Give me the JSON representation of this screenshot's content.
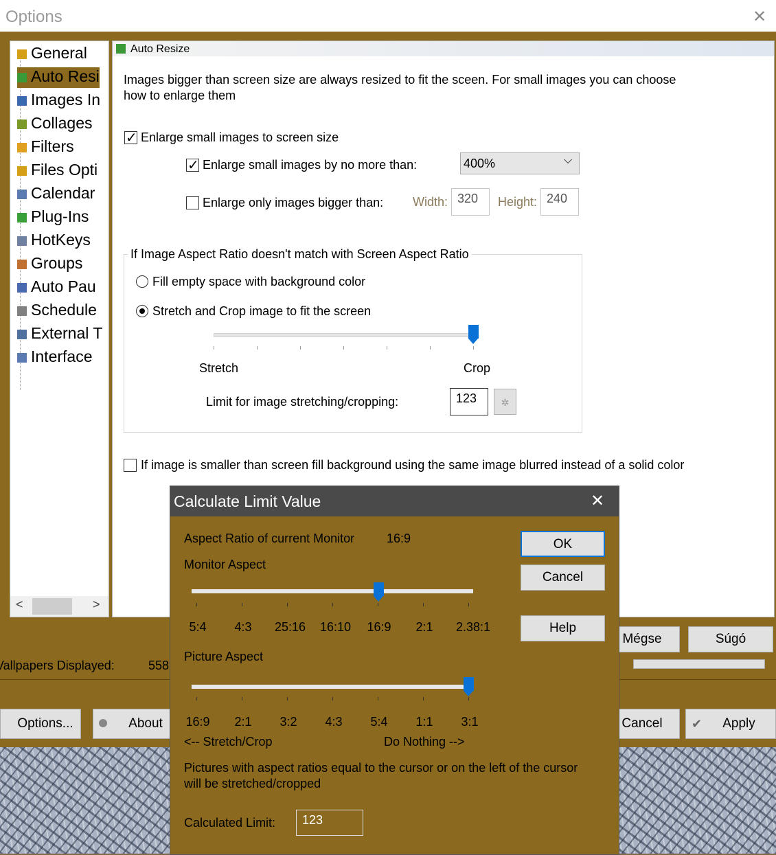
{
  "options_window": {
    "title": "Options",
    "close_glyph": "✕",
    "tree": {
      "items": [
        {
          "label": "General",
          "icon": "pencil-icon",
          "color": "#d4a017"
        },
        {
          "label": "Auto Resi",
          "icon": "resize-icon",
          "color": "#3a9a3a"
        },
        {
          "label": "Images In",
          "icon": "image-icon",
          "color": "#3a6ab0"
        },
        {
          "label": "Collages",
          "icon": "collage-icon",
          "color": "#7a9a2a"
        },
        {
          "label": "Filters",
          "icon": "filter-icon",
          "color": "#e0a020"
        },
        {
          "label": "Files Opti",
          "icon": "files-icon",
          "color": "#d4a017"
        },
        {
          "label": "Calendar",
          "icon": "calendar-icon",
          "color": "#5a7ab0"
        },
        {
          "label": "Plug-Ins",
          "icon": "puzzle-icon",
          "color": "#3aa03a"
        },
        {
          "label": "HotKeys",
          "icon": "keyboard-icon",
          "color": "#7080a0"
        },
        {
          "label": "Groups",
          "icon": "groups-icon",
          "color": "#c07030"
        },
        {
          "label": "Auto Pau",
          "icon": "pause-icon",
          "color": "#4a6ab0"
        },
        {
          "label": "Schedule",
          "icon": "clock-icon",
          "color": "#808080"
        },
        {
          "label": "External T",
          "icon": "wrench-icon",
          "color": "#5070a0"
        },
        {
          "label": "Interface",
          "icon": "window-icon",
          "color": "#5a7ab0"
        }
      ],
      "selected_index": 1,
      "scroll_left": "<",
      "scroll_right": ">"
    },
    "panel": {
      "header": "Auto Resize",
      "intro_line1": "Images bigger than screen size are always resized to fit the sceen. For small images you can choose",
      "intro_line2": "how to enlarge them",
      "enlarge_small": {
        "label": "Enlarge small images to screen size",
        "checked": true
      },
      "enlarge_no_more": {
        "label": "Enlarge small images by no more than:",
        "checked": true
      },
      "enlarge_dropdown": {
        "value": "400%",
        "arrow": "⌵"
      },
      "enlarge_only": {
        "label": "Enlarge only images bigger than:",
        "checked": false
      },
      "width_label": "Width:",
      "width_value": "320",
      "height_label": "Height:",
      "height_value": "240",
      "group_title": "If Image Aspect Ratio doesn't match with Screen Aspect Ratio",
      "radio_fill": {
        "label": "Fill empty space with background color",
        "checked": false
      },
      "radio_stretch": {
        "label": "Stretch and Crop image to fit the screen",
        "checked": true
      },
      "slider_stretch_crop": {
        "level": 1.0
      },
      "stretch_label": "Stretch",
      "crop_label": "Crop",
      "limit_label": "Limit for image stretching/cropping:",
      "limit_value": "123",
      "blur_option": {
        "label": "If image is smaller than screen fill background using the same image blurred instead of a solid color",
        "checked": false
      }
    },
    "lower": {
      "wallpapers_label": "Vallpapers Displayed:",
      "wallpapers_value": "558",
      "megse": "Mégse",
      "sugo": "Súgó",
      "options_btn": "Options...",
      "about_btn": "About",
      "cancel_btn": "Cancel",
      "apply_btn": "Apply"
    }
  },
  "dialog": {
    "title": "Calculate Limit Value",
    "close_glyph": "✕",
    "aspect_label": "Aspect Ratio of current Monitor",
    "aspect_value": "16:9",
    "monitor_aspect_label": "Monitor Aspect",
    "monitor_ticks": [
      "5:4",
      "4:3",
      "25:16",
      "16:10",
      "16:9",
      "2:1",
      "2.38:1"
    ],
    "monitor_slider": {
      "selected": "16:9",
      "level": 0.67
    },
    "picture_aspect_label": "Picture Aspect",
    "picture_ticks": [
      "16:9",
      "2:1",
      "3:2",
      "4:3",
      "5:4",
      "1:1",
      "3:1"
    ],
    "picture_slider": {
      "selected": "3:1",
      "level": 1.0
    },
    "left_hint": "<-- Stretch/Crop",
    "right_hint": "Do Nothing -->",
    "explain_line1": "Pictures with aspect ratios equal to the cursor or on the left of the cursor",
    "explain_line2": "will be stretched/cropped",
    "calc_label": "Calculated Limit:",
    "calc_value": "123",
    "ok": "OK",
    "cancel": "Cancel",
    "help": "Help"
  },
  "colors": {
    "brand_bg": "#8b6a1f",
    "slider_thumb": "#0a72d6"
  }
}
